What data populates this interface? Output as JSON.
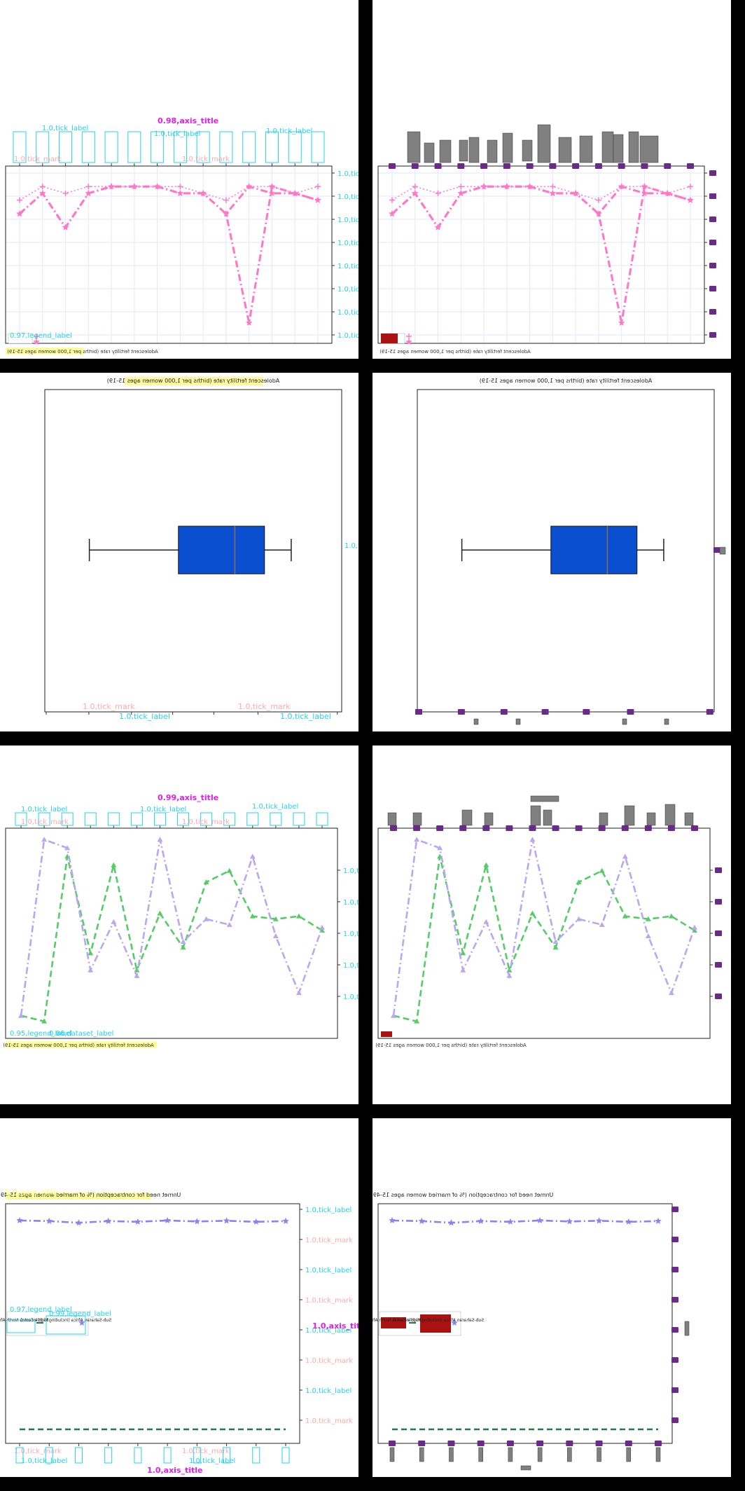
{
  "colors": {
    "background": "#000000",
    "panel": "#ffffff",
    "pink": "#ff77c8",
    "blue_box": "#0b4fd1",
    "green": "#55cc66",
    "lavender": "#b9a8f0",
    "periwinkle": "#8d82f2",
    "dark_green": "#1f7a45",
    "cyan_overlay": "#22d3ee",
    "magenta_overlay": "#e020e0",
    "salmon_overlay": "#ffaaaa",
    "yellow_highlight": "#ffff88",
    "purple_marker": "#6a2a8a",
    "gray_box": "#808080",
    "red_box": "#aa1111"
  },
  "overlay_labels": {
    "tick_label": "1.0,tick_label",
    "tick_mark": "1.0,tick_mark",
    "axis_title_a": "0.98,axis_title",
    "axis_title_b": "0.99,axis_title",
    "axis_title_c": "1.0,axis_title",
    "legend_label_a": "0.97,legend_label",
    "legend_label_b": "0.95,legend_label",
    "legend_label_c": "0.99,legend_label",
    "dataset_label": "0.86,dataset_label"
  },
  "chart_data": [
    {
      "type": "line",
      "title": "",
      "footer_text": "Adolescent fertility rate (births per 1,000 women ages 15-19)",
      "x": [
        1,
        2,
        3,
        4,
        5,
        6,
        7,
        8,
        9,
        10,
        11,
        12,
        13,
        14
      ],
      "series": [
        {
          "name": "",
          "style": "dotted",
          "marker": "plus",
          "values": [
            0.987,
            0.989,
            0.988,
            0.989,
            0.989,
            0.989,
            0.989,
            0.989,
            0.988,
            0.987,
            0.989,
            0.989,
            0.988,
            0.989
          ]
        },
        {
          "name": "",
          "style": "dashdot",
          "marker": "star",
          "values": [
            0.985,
            0.988,
            0.983,
            0.988,
            0.989,
            0.989,
            0.989,
            0.988,
            0.988,
            0.985,
            0.989,
            0.988,
            0.988,
            0.987
          ]
        },
        {
          "name": "",
          "style": "dashdot",
          "marker": "star",
          "values": [
            0.985,
            0.988,
            0.983,
            0.988,
            0.989,
            0.989,
            0.989,
            0.988,
            0.988,
            0.985,
            0.969,
            0.989,
            0.988,
            0.987
          ]
        }
      ],
      "ylim": [
        0.966,
        0.992
      ]
    },
    {
      "type": "box",
      "title": "Adolescent fertility rate (births per 1,000 women ages 15-19)",
      "min": 0.15,
      "q1": 0.45,
      "median": 0.64,
      "q3": 0.74,
      "max": 0.83,
      "xlim": [
        0,
        1
      ]
    },
    {
      "type": "line",
      "title": "",
      "footer_text": "Adolescent fertility rate (births per 1,000 women ages 15-19)",
      "x": [
        1,
        2,
        3,
        4,
        5,
        6,
        7,
        8,
        9,
        10,
        11,
        12,
        13,
        14
      ],
      "series": [
        {
          "name": "",
          "style": "dashed",
          "marker": "triangle",
          "values": [
            0.36,
            0.34,
            0.92,
            0.58,
            0.89,
            0.52,
            0.72,
            0.6,
            0.83,
            0.87,
            0.71,
            0.7,
            0.71,
            0.66
          ]
        },
        {
          "name": "",
          "style": "dashdot",
          "marker": "triangle",
          "values": [
            0.36,
            0.98,
            0.95,
            0.52,
            0.69,
            0.5,
            0.98,
            0.62,
            0.7,
            0.68,
            0.92,
            0.64,
            0.44,
            0.67
          ]
        }
      ],
      "ylim": [
        0.28,
        1.02
      ]
    },
    {
      "type": "line",
      "title": "Unmet need for contraception (% of married women ages 15-49)",
      "x": [
        1,
        2,
        3,
        4,
        5,
        6,
        7,
        8,
        9,
        10
      ],
      "series": [
        {
          "name": "Middle East & North Africa",
          "style": "dashdot",
          "marker": "star",
          "values": [
            0.995,
            0.993,
            0.988,
            0.993,
            0.991,
            0.995,
            0.992,
            0.994,
            0.991,
            0.993
          ]
        },
        {
          "name": "Sub-Saharan Africa (including high income)",
          "style": "dashed",
          "marker": "none",
          "values": [
            0.35,
            0.35,
            0.35,
            0.35,
            0.35,
            0.35,
            0.35,
            0.35,
            0.35,
            0.35
          ]
        }
      ],
      "ylim": [
        0.3,
        1.02
      ]
    }
  ]
}
